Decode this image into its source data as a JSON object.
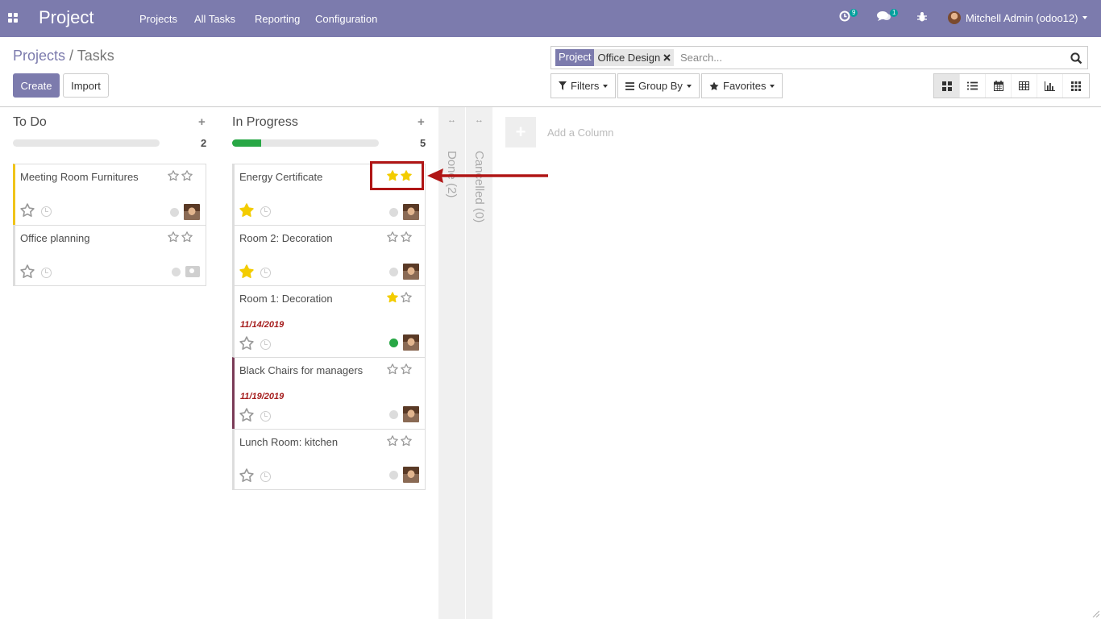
{
  "navbar": {
    "brand": "Project",
    "menu": [
      "Projects",
      "All Tasks",
      "Reporting",
      "Configuration"
    ],
    "activity_count": "9",
    "message_count": "1",
    "user_name": "Mitchell Admin (odoo12)"
  },
  "breadcrumb": {
    "parent": "Projects",
    "separator": "/",
    "current": "Tasks"
  },
  "buttons": {
    "create": "Create",
    "import": "Import"
  },
  "search": {
    "facet_category": "Project",
    "facet_value": "Office Design",
    "placeholder": "Search..."
  },
  "filters": {
    "filters": "Filters",
    "group_by": "Group By",
    "favorites": "Favorites"
  },
  "views": [
    "kanban-icon",
    "list-icon",
    "calendar-icon",
    "pivot-icon",
    "graph-icon",
    "grid-icon"
  ],
  "columns": [
    {
      "title": "To Do",
      "count": "2",
      "progress": 0,
      "cards": [
        {
          "name": "Meeting Room Furnitures",
          "priority": 0,
          "starred": false,
          "date": "",
          "status": "grey",
          "assignee": "avatar",
          "accent": "#f0c419"
        },
        {
          "name": "Office planning",
          "priority": 0,
          "starred": false,
          "date": "",
          "status": "grey",
          "assignee": "camera",
          "accent": "#ddd"
        }
      ]
    },
    {
      "title": "In Progress",
      "count": "5",
      "progress": 0.2,
      "cards": [
        {
          "name": "Energy Certificate",
          "priority": 2,
          "starred": true,
          "date": "",
          "status": "grey",
          "assignee": "avatar",
          "accent": "#ddd"
        },
        {
          "name": "Room 2: Decoration",
          "priority": 0,
          "starred": true,
          "date": "",
          "status": "grey",
          "assignee": "avatar",
          "accent": "#ddd"
        },
        {
          "name": "Room 1: Decoration",
          "priority": 1,
          "starred": false,
          "date": "11/14/2019",
          "status": "green",
          "assignee": "avatar",
          "accent": "#ddd"
        },
        {
          "name": "Black Chairs for managers",
          "priority": 0,
          "starred": false,
          "date": "11/19/2019",
          "status": "grey",
          "assignee": "avatar",
          "accent": "#7a3b57"
        },
        {
          "name": "Lunch Room: kitchen",
          "priority": 0,
          "starred": false,
          "date": "",
          "status": "grey",
          "assignee": "avatar",
          "accent": "#ddd"
        }
      ]
    }
  ],
  "folded_columns": [
    {
      "label": "Done (2)"
    },
    {
      "label": "Cancelled (0)"
    }
  ],
  "add_column": {
    "label": "Add a Column"
  },
  "colors": {
    "brand": "#7c7bad",
    "star": "#f3cc00",
    "highlight": "#b01616",
    "success": "#28a745"
  }
}
